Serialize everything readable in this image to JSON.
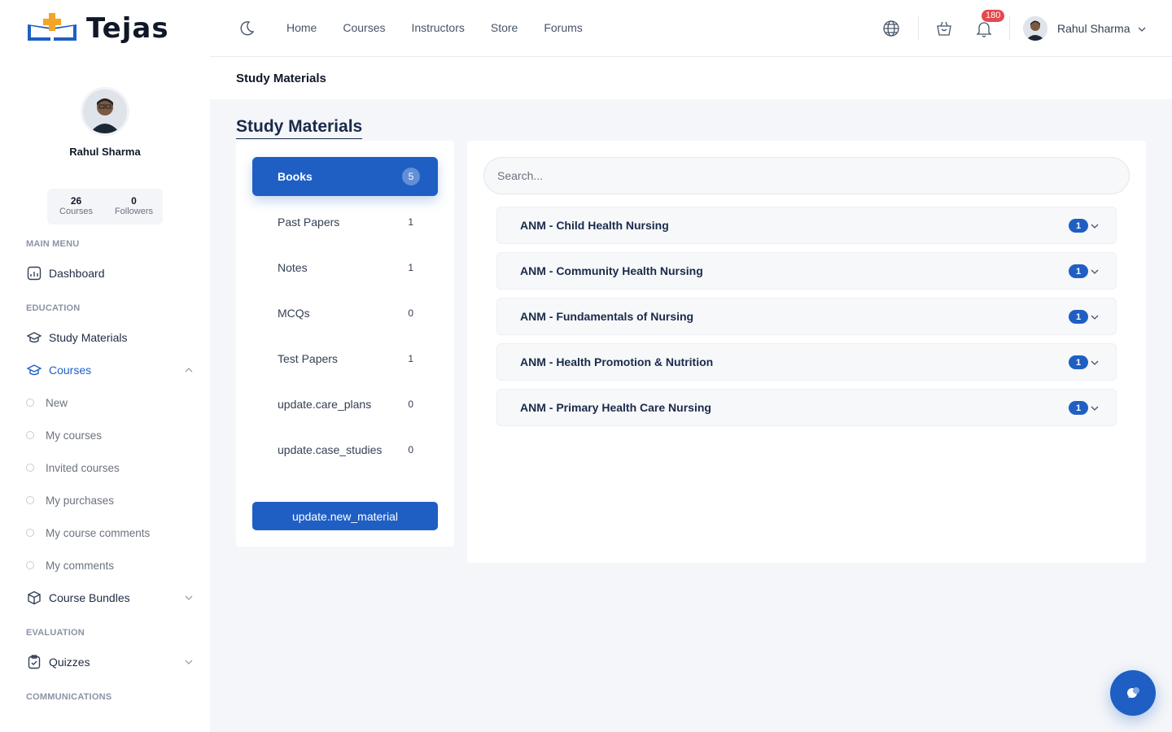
{
  "brand": {
    "name": "Tejas"
  },
  "colors": {
    "primary": "#1f5fc4",
    "badge": "#e5484d"
  },
  "profile": {
    "name": "Rahul Sharma",
    "courses_count": "26",
    "courses_label": "Courses",
    "followers_count": "0",
    "followers_label": "Followers"
  },
  "sidebar": {
    "main_menu_label": "MAIN MENU",
    "dashboard": "Dashboard",
    "education_label": "EDUCATION",
    "study_materials": "Study Materials",
    "courses": "Courses",
    "course_sub": [
      "New",
      "My courses",
      "Invited courses",
      "My purchases",
      "My course comments",
      "My comments"
    ],
    "course_bundles": "Course Bundles",
    "evaluation_label": "EVALUATION",
    "quizzes": "Quizzes",
    "communications_label": "COMMUNICATIONS"
  },
  "topbar": {
    "nav": [
      "Home",
      "Courses",
      "Instructors",
      "Store",
      "Forums"
    ],
    "notification_count": "180",
    "user_name": "Rahul Sharma"
  },
  "breadcrumb": "Study Materials",
  "page_title": "Study Materials",
  "categories": [
    {
      "label": "Books",
      "count": "5"
    },
    {
      "label": "Past Papers",
      "count": "1"
    },
    {
      "label": "Notes",
      "count": "1"
    },
    {
      "label": "MCQs",
      "count": "0"
    },
    {
      "label": "Test Papers",
      "count": "1"
    },
    {
      "label": "update.care_plans",
      "count": "0"
    },
    {
      "label": "update.case_studies",
      "count": "0"
    }
  ],
  "new_material_label": "update.new_material",
  "search": {
    "placeholder": "Search..."
  },
  "materials": [
    {
      "title": "ANM - Child Health Nursing",
      "count": "1"
    },
    {
      "title": "ANM - Community Health Nursing",
      "count": "1"
    },
    {
      "title": "ANM - Fundamentals of Nursing",
      "count": "1"
    },
    {
      "title": "ANM - Health Promotion & Nutrition",
      "count": "1"
    },
    {
      "title": "ANM - Primary Health Care Nursing",
      "count": "1"
    }
  ]
}
